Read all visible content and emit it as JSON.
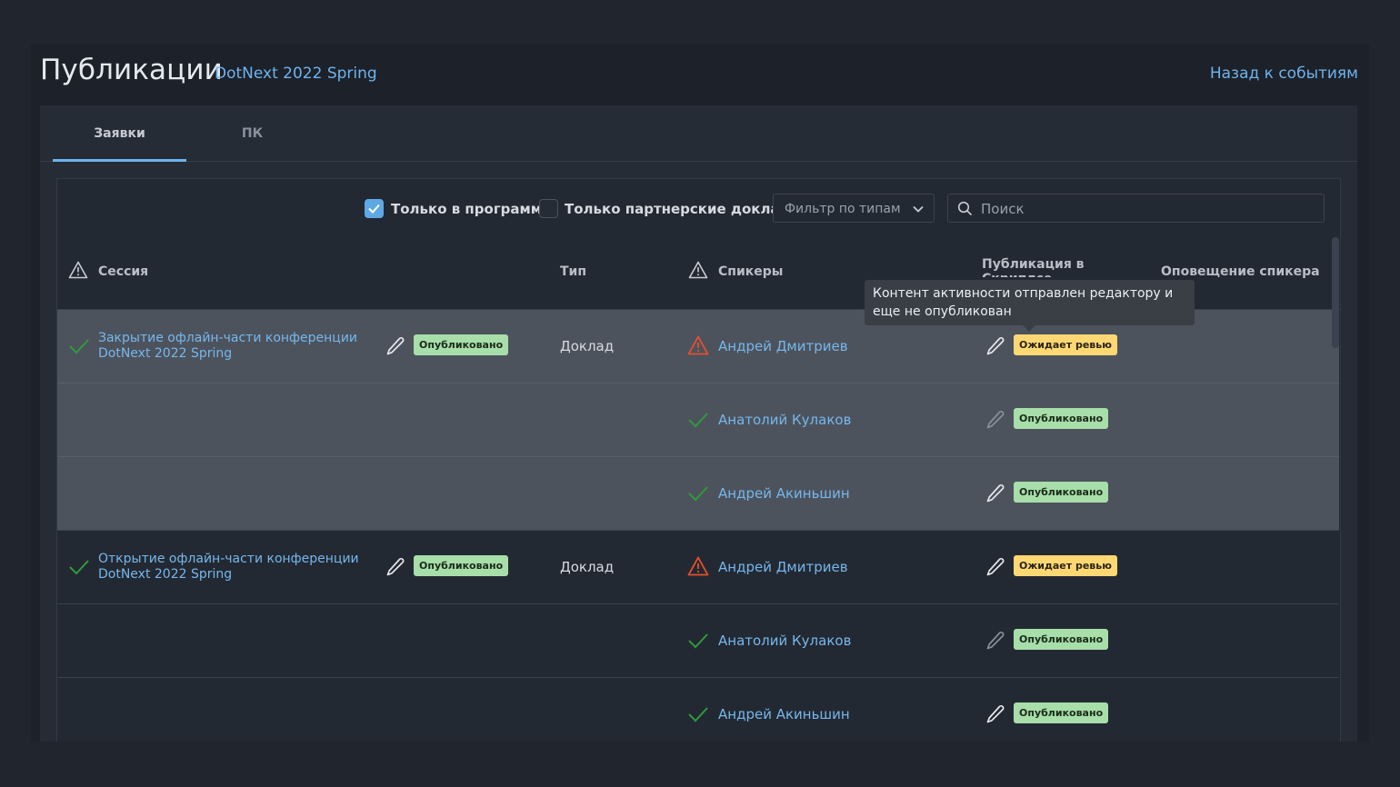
{
  "header": {
    "title": "Публикации",
    "event": "DotNext 2022 Spring",
    "back_link": "Назад к событиям"
  },
  "tabs": [
    {
      "label": "Заявки",
      "active": true
    },
    {
      "label": "ПК",
      "active": false
    }
  ],
  "toolbar": {
    "only_program": {
      "label": "Только в программе",
      "checked": true
    },
    "only_partner": {
      "label": "Только партнерские доклады",
      "checked": false
    },
    "type_filter": {
      "placeholder": "Фильтр по типам"
    },
    "search": {
      "placeholder": "Поиск"
    }
  },
  "columns": {
    "session": "Сессия",
    "type": "Тип",
    "speakers": "Спикеры",
    "publication": "Публикация в Скриплсе",
    "notification": "Оповещение спикера"
  },
  "tooltip": "Контент активности отправлен редактору и еще не опубликован",
  "sessions": [
    {
      "title": "Закрытие офлайн-части конференции DotNext 2022 Spring",
      "status": "Опубликовано",
      "type": "Доклад",
      "speakers": [
        {
          "name": "Андрей Дмитриев",
          "state": "warning",
          "publication": "Ожидает ревью"
        },
        {
          "name": "Анатолий Кулаков",
          "state": "ok",
          "publication": "Опубликовано"
        },
        {
          "name": "Андрей Акиньшин",
          "state": "ok",
          "publication": "Опубликовано"
        }
      ]
    },
    {
      "title": "Открытие офлайн-части конференции DotNext 2022 Spring",
      "status": "Опубликовано",
      "type": "Доклад",
      "speakers": [
        {
          "name": "Андрей Дмитриев",
          "state": "warning",
          "publication": "Ожидает ревью"
        },
        {
          "name": "Анатолий Кулаков",
          "state": "ok",
          "publication": "Опубликовано"
        },
        {
          "name": "Андрей Акиньшин",
          "state": "ok",
          "publication": "Опубликовано"
        }
      ]
    }
  ],
  "colors": {
    "accent": "#6fb3ea",
    "ok_check": "#2f9a3c",
    "warning": "#e4502d",
    "badge_published": "#a7dea9",
    "badge_review": "#ffd874"
  }
}
